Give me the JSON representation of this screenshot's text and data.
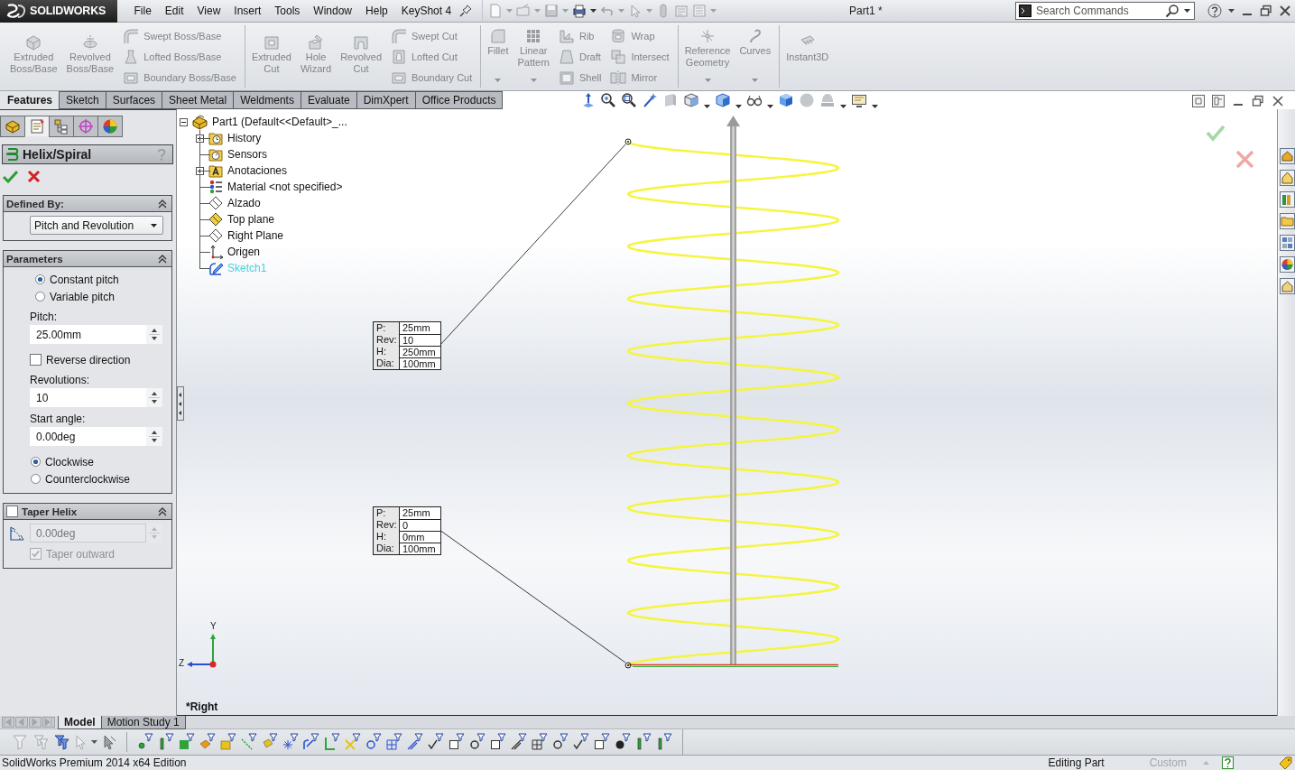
{
  "title_bar": {
    "logo": "SOLIDWORKS",
    "menu": [
      "File",
      "Edit",
      "View",
      "Insert",
      "Tools",
      "Window",
      "Help",
      "KeyShot 4"
    ],
    "document": "Part1 *",
    "search": {
      "placeholder": "Search Commands"
    }
  },
  "ribbon": {
    "groups": [
      {
        "columns": [
          {
            "kind": "large",
            "label": "Extruded Boss/Base",
            "dropdown": false,
            "disabled": true
          },
          {
            "kind": "large",
            "label": "Revolved Boss/Base",
            "dropdown": false,
            "disabled": true
          },
          {
            "kind": "stack",
            "items": [
              {
                "label": "Swept Boss/Base",
                "disabled": true
              },
              {
                "label": "Lofted Boss/Base",
                "disabled": true
              },
              {
                "label": "Boundary Boss/Base",
                "disabled": true
              }
            ]
          }
        ]
      },
      {
        "columns": [
          {
            "kind": "large",
            "label": "Extruded Cut",
            "dropdown": false,
            "disabled": true
          },
          {
            "kind": "large",
            "label": "Hole Wizard",
            "dropdown": false,
            "disabled": true
          },
          {
            "kind": "large",
            "label": "Revolved Cut",
            "dropdown": false,
            "disabled": true
          },
          {
            "kind": "stack",
            "items": [
              {
                "label": "Swept Cut",
                "disabled": true
              },
              {
                "label": "Lofted Cut",
                "disabled": true
              },
              {
                "label": "Boundary Cut",
                "disabled": true
              }
            ]
          }
        ]
      },
      {
        "columns": [
          {
            "kind": "large",
            "label": "Fillet",
            "dropdown": true,
            "disabled": true
          },
          {
            "kind": "large",
            "label": "Linear Pattern",
            "dropdown": true,
            "disabled": true
          },
          {
            "kind": "stack",
            "items": [
              {
                "label": "Rib",
                "disabled": true
              },
              {
                "label": "Draft",
                "disabled": true
              },
              {
                "label": "Shell",
                "disabled": true
              }
            ]
          },
          {
            "kind": "stack",
            "items": [
              {
                "label": "Wrap",
                "disabled": true
              },
              {
                "label": "Intersect",
                "disabled": true
              },
              {
                "label": "Mirror",
                "disabled": true
              }
            ]
          }
        ]
      },
      {
        "columns": [
          {
            "kind": "large",
            "label": "Reference Geometry",
            "dropdown": true,
            "disabled": true
          },
          {
            "kind": "large",
            "label": "Curves",
            "dropdown": true,
            "disabled": true
          }
        ]
      },
      {
        "columns": [
          {
            "kind": "large",
            "label": "Instant3D",
            "dropdown": false,
            "disabled": true
          }
        ]
      }
    ]
  },
  "tabs": [
    {
      "label": "Features",
      "selected": true
    },
    {
      "label": "Sketch",
      "selected": false
    },
    {
      "label": "Surfaces",
      "selected": false
    },
    {
      "label": "Sheet Metal",
      "selected": false
    },
    {
      "label": "Weldments",
      "selected": false
    },
    {
      "label": "Evaluate",
      "selected": false
    },
    {
      "label": "DimXpert",
      "selected": false
    },
    {
      "label": "Office Products",
      "selected": false
    }
  ],
  "property_manager": {
    "tabs": [
      {
        "kind": "features",
        "selected": false
      },
      {
        "kind": "properties",
        "selected": true
      },
      {
        "kind": "configurations",
        "selected": false
      },
      {
        "kind": "dimxpert",
        "selected": false
      },
      {
        "kind": "display",
        "selected": false
      }
    ],
    "title": "Helix/Spiral",
    "sections": [
      {
        "title": "Defined By:",
        "expanded": true,
        "controls": [
          {
            "kind": "select",
            "value": "Pitch and Revolution"
          }
        ]
      },
      {
        "title": "Parameters",
        "expanded": true,
        "controls": [
          {
            "kind": "radio",
            "label": "Constant pitch",
            "selected": true
          },
          {
            "kind": "radio",
            "label": "Variable pitch",
            "selected": false
          },
          {
            "kind": "spin",
            "label": "Pitch:",
            "value": "25.00mm",
            "disabled": false
          },
          {
            "kind": "checkbox",
            "label": "Reverse direction",
            "checked": false,
            "disabled": false
          },
          {
            "kind": "spin",
            "label": "Revolutions:",
            "value": "10",
            "disabled": false
          },
          {
            "kind": "spin",
            "label": "Start angle:",
            "value": "0.00deg",
            "disabled": false
          },
          {
            "kind": "radio",
            "label": "Clockwise",
            "selected": true
          },
          {
            "kind": "radio",
            "label": "Counterclockwise",
            "selected": false
          }
        ]
      },
      {
        "title": "Taper Helix",
        "checked": false,
        "expanded": true,
        "controls": [
          {
            "kind": "taper",
            "value": "0.00deg",
            "disabled": true
          },
          {
            "kind": "checkbox",
            "label": "Taper outward",
            "checked": true,
            "disabled": true
          }
        ]
      }
    ]
  },
  "feature_tree": {
    "label": "Part1 (Default<<Default>_...",
    "expanded": true,
    "children": [
      {
        "label": "History",
        "kind": "history",
        "expanded": false,
        "highlighted": false
      },
      {
        "label": "Sensors",
        "kind": "sensors",
        "highlighted": false
      },
      {
        "label": "Anotaciones",
        "kind": "annotations",
        "expanded": false,
        "highlighted": false
      },
      {
        "label": "Material <not specified>",
        "kind": "material",
        "highlighted": false
      },
      {
        "label": "Alzado",
        "kind": "plane",
        "highlighted": false
      },
      {
        "label": "Top plane",
        "kind": "activeplane",
        "highlighted": false
      },
      {
        "label": "Right Plane",
        "kind": "plane",
        "highlighted": false
      },
      {
        "label": "Origen",
        "kind": "origin",
        "highlighted": false
      },
      {
        "label": "Sketch1",
        "kind": "sketch",
        "highlighted": true
      }
    ]
  },
  "callouts": [
    {
      "rows": [
        {
          "key": "P:",
          "value": "25mm"
        },
        {
          "key": "Rev:",
          "value": "10"
        },
        {
          "key": "H:",
          "value": "250mm"
        },
        {
          "key": "Dia:",
          "value": "100mm"
        }
      ]
    },
    {
      "rows": [
        {
          "key": "P:",
          "value": "25mm"
        },
        {
          "key": "Rev:",
          "value": "0"
        },
        {
          "key": "H:",
          "value": "0mm"
        },
        {
          "key": "Dia:",
          "value": "100mm"
        }
      ]
    }
  ],
  "triad": {
    "labels": [
      "Y",
      "Z"
    ]
  },
  "view_name": "*Right",
  "bottom_tabs": [
    {
      "label": "Model",
      "selected": true
    },
    {
      "label": "Motion Study 1",
      "selected": false
    }
  ],
  "status_bar": {
    "product": "SolidWorks Premium 2014 x64 Edition",
    "mode": "Editing Part",
    "units": {
      "label": "Custom",
      "disabled": true
    }
  }
}
